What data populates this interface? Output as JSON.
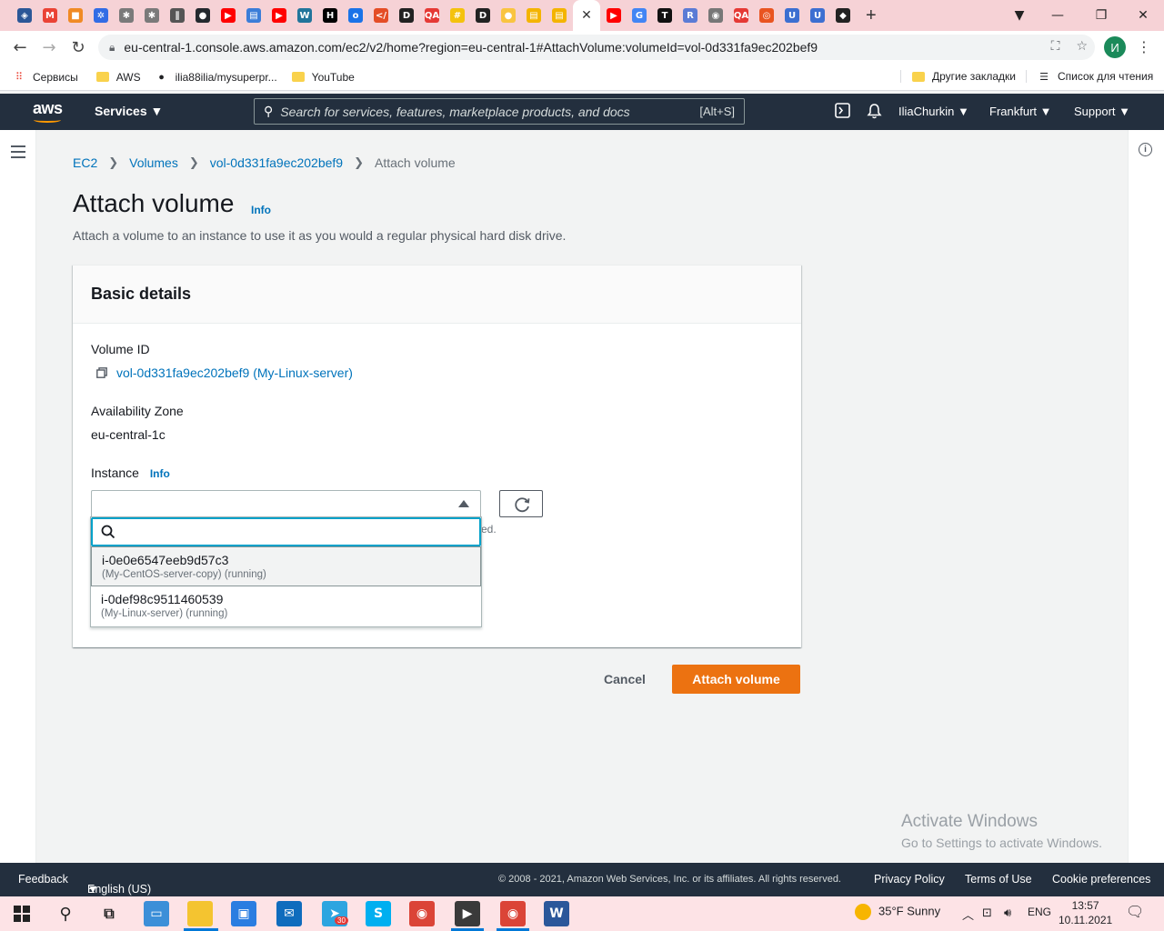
{
  "browser": {
    "tabs": [
      {
        "icon": "shield-icon",
        "color": "#2b5797"
      },
      {
        "icon": "gmail-icon",
        "color": "#ea4335"
      },
      {
        "icon": "box-icon",
        "color": "#f08a24"
      },
      {
        "icon": "kubernetes-icon",
        "color": "#326ce5"
      },
      {
        "icon": "helm-icon",
        "color": "#7a7a7a"
      },
      {
        "icon": "helm-icon",
        "color": "#7a7a7a"
      },
      {
        "icon": "clip-icon",
        "color": "#555555"
      },
      {
        "icon": "github-icon",
        "color": "#24292e"
      },
      {
        "icon": "youtube-icon",
        "color": "#ff0000"
      },
      {
        "icon": "chart-icon",
        "color": "#3b7dd8"
      },
      {
        "icon": "youtube-icon",
        "color": "#ff0000"
      },
      {
        "icon": "wp-icon",
        "color": "#21759b"
      },
      {
        "icon": "hashicorp-icon",
        "color": "#000000"
      },
      {
        "icon": "o-icon",
        "color": "#1a73e8"
      },
      {
        "icon": "code-icon",
        "color": "#e44d26"
      },
      {
        "icon": "d-icon",
        "color": "#222222"
      },
      {
        "icon": "qa-icon",
        "color": "#e53935"
      },
      {
        "icon": "hash-icon",
        "color": "#f4c20d"
      },
      {
        "icon": "d-icon",
        "color": "#222222"
      },
      {
        "icon": "circle-icon",
        "color": "#f9c440"
      },
      {
        "icon": "doc-icon",
        "color": "#f4b400"
      },
      {
        "icon": "doc-icon",
        "color": "#f4b400"
      }
    ],
    "active_tab_close": "✕",
    "tabs_right": [
      {
        "icon": "youtube-icon",
        "color": "#ff0000"
      },
      {
        "icon": "google-icon",
        "color": "#4285f4"
      },
      {
        "icon": "t-icon",
        "color": "#111111"
      },
      {
        "icon": "r-icon",
        "color": "#5b7bd5"
      },
      {
        "icon": "chrome-icon",
        "color": "#777777"
      },
      {
        "icon": "qa-icon",
        "color": "#e53935"
      },
      {
        "icon": "ubuntu-icon",
        "color": "#e95420"
      },
      {
        "icon": "u-icon",
        "color": "#3c6fd1"
      },
      {
        "icon": "u-icon",
        "color": "#3c6fd1"
      },
      {
        "icon": "linux-icon",
        "color": "#222222"
      }
    ],
    "url": "eu-central-1.console.aws.amazon.com/ec2/v2/home?region=eu-central-1#AttachVolume:volumeId=vol-0d331fa9ec202bef9",
    "profile_initial": "И",
    "bookmarks": {
      "apps": "Сервисы",
      "aws": "AWS",
      "github": "ilia88ilia/mysuperpr...",
      "youtube": "YouTube",
      "other": "Другие закладки",
      "reading": "Список для чтения"
    }
  },
  "aws_nav": {
    "logo": "aws",
    "services": "Services",
    "search_placeholder": "Search for services, features, marketplace products, and docs",
    "search_shortcut": "[Alt+S]",
    "user": "IliaChurkin",
    "region": "Frankfurt",
    "support": "Support"
  },
  "breadcrumb": {
    "ec2": "EC2",
    "volumes": "Volumes",
    "volume_id": "vol-0d331fa9ec202bef9",
    "current": "Attach volume"
  },
  "page": {
    "title": "Attach volume",
    "title_info": "Info",
    "description": "Attach a volume to an instance to use it as you would a regular physical hard disk drive."
  },
  "basic_details": {
    "heading": "Basic details",
    "volume_id_label": "Volume ID",
    "volume_id_value": "vol-0d331fa9ec202bef9 (My-Linux-server)",
    "az_label": "Availability Zone",
    "az_value": "eu-central-1c",
    "instance_label": "Instance",
    "instance_info": "Info",
    "instance_selected": "",
    "filter_placeholder": "",
    "hint_tail": "ed.",
    "options": [
      {
        "id": "i-0e0e6547eeb9d57c3",
        "sub": "(My-CentOS-server-copy) (running)",
        "highlighted": true
      },
      {
        "id": "i-0def98c9511460539",
        "sub": "(My-Linux-server) (running)",
        "highlighted": false
      }
    ]
  },
  "actions": {
    "cancel": "Cancel",
    "attach": "Attach volume",
    "accent": "#ec7211"
  },
  "watermark": {
    "line1": "Activate Windows",
    "line2": "Go to Settings to activate Windows."
  },
  "footer": {
    "feedback": "Feedback",
    "language": "English (US)",
    "copyright": "© 2008 - 2021, Amazon Web Services, Inc. or its affiliates. All rights reserved.",
    "privacy": "Privacy Policy",
    "terms": "Terms of Use",
    "cookies": "Cookie preferences"
  },
  "taskbar": {
    "apps": [
      {
        "icon": "telegram-icon",
        "color": "#2ca5e0",
        "badge": "30"
      },
      {
        "icon": "skype-icon",
        "color": "#00aff0"
      },
      {
        "icon": "chrome-icon",
        "color": "#db4437"
      },
      {
        "icon": "terminal-icon",
        "color": "#3a3a3a"
      },
      {
        "icon": "chrome-icon",
        "color": "#db4437"
      },
      {
        "icon": "word-icon",
        "color": "#2b579a"
      }
    ],
    "weather": "35°F  Sunny",
    "lang": "ENG",
    "time": "13:57",
    "date": "10.11.2021"
  }
}
